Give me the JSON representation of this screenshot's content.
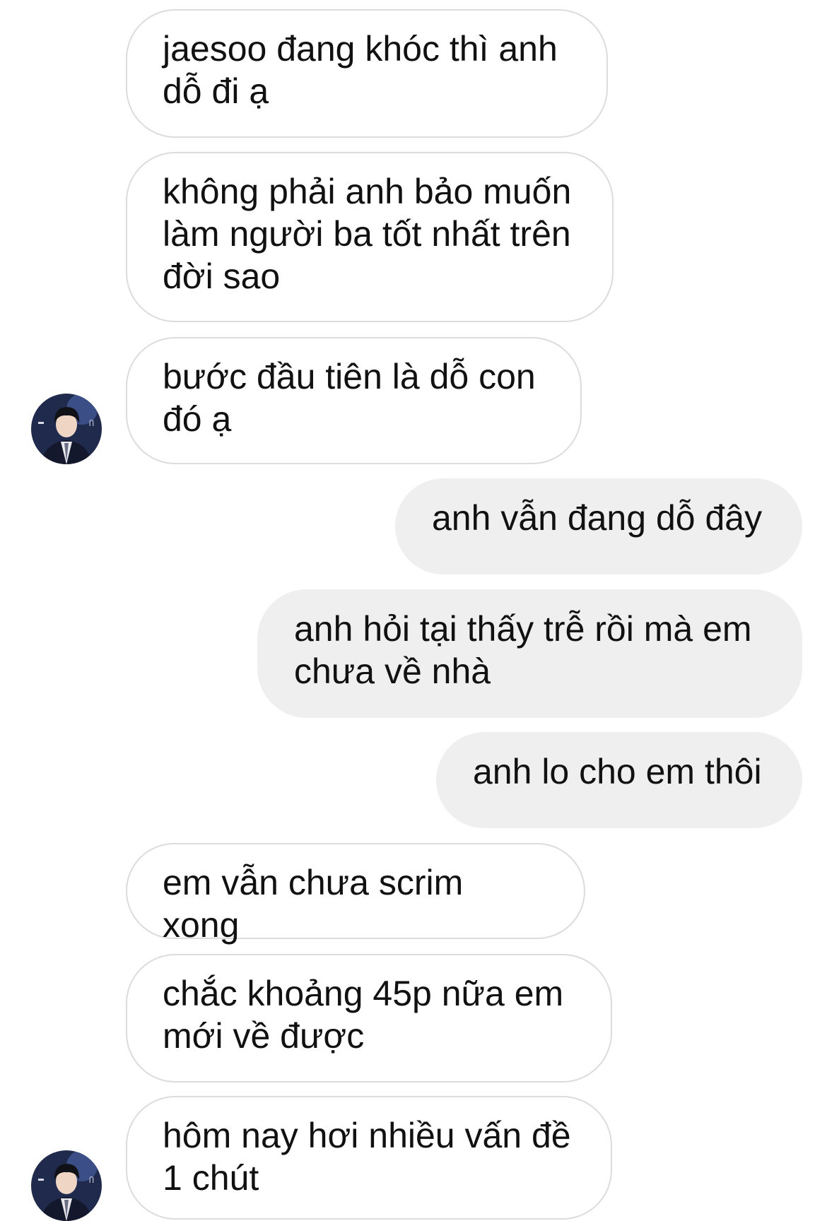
{
  "conversation": {
    "messages": [
      {
        "sender": "them",
        "text": "jaesoo đang khóc thì anh\ndỗ đi ạ"
      },
      {
        "sender": "them",
        "text": "không phải anh bảo muốn\nlàm người ba tốt nhất trên\nđời sao"
      },
      {
        "sender": "them",
        "text": "bước đầu tiên là dỗ con\nđó ạ"
      },
      {
        "sender": "me",
        "text": "anh vẫn đang dỗ đây"
      },
      {
        "sender": "me",
        "text": "anh hỏi tại thấy trễ rồi mà em\nchưa về nhà"
      },
      {
        "sender": "me",
        "text": "anh lo cho em thôi"
      },
      {
        "sender": "them",
        "text": "em vẫn chưa scrim xong"
      },
      {
        "sender": "them",
        "text": "chắc khoảng 45p nữa em\nmới về được"
      },
      {
        "sender": "them",
        "text": "hôm nay hơi nhiều vấn đề\n1 chút"
      }
    ],
    "avatar_icon": "contact-photo"
  },
  "colors": {
    "incoming_bubble_bg": "#ffffff",
    "incoming_bubble_border": "#dcdcdc",
    "outgoing_bubble_bg": "#efefef",
    "text": "#111111",
    "avatar_bg": "#1f2a4d"
  }
}
